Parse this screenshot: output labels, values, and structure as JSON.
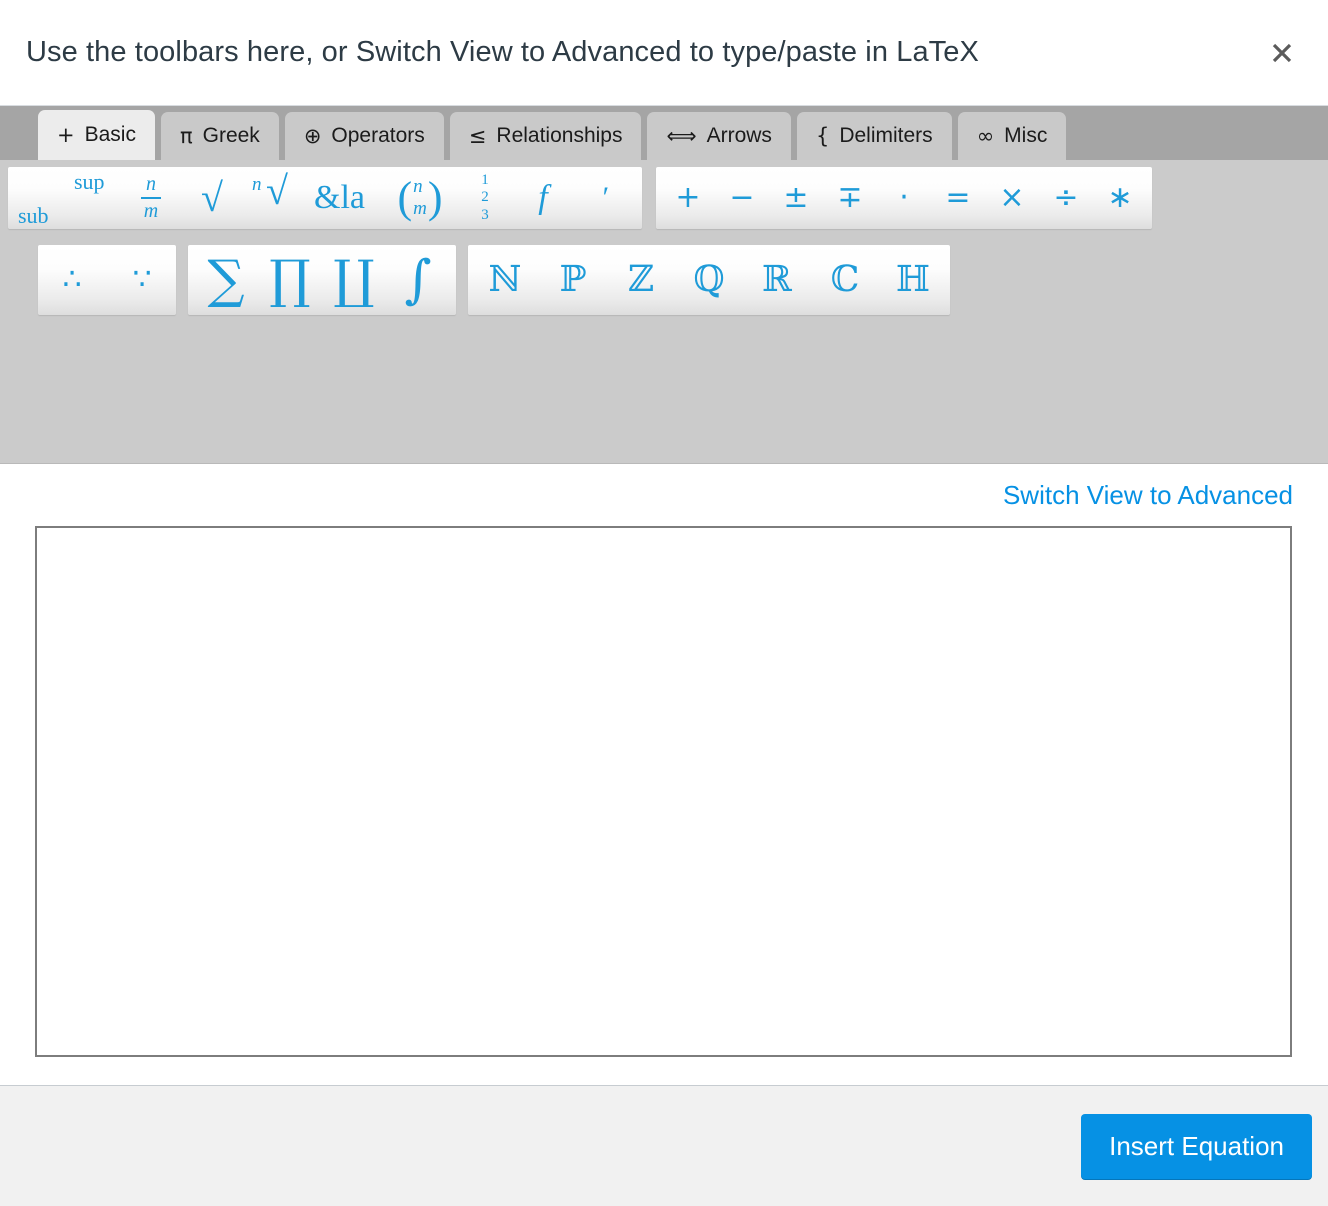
{
  "header": {
    "title": "Use the toolbars here, or Switch View to Advanced to type/paste in LaTeX",
    "close_icon": "close-icon"
  },
  "tabs": [
    {
      "icon": "+",
      "icon_name": "plus-icon",
      "label": "Basic",
      "active": true
    },
    {
      "icon": "π",
      "icon_name": "pi-icon",
      "label": "Greek",
      "active": false
    },
    {
      "icon": "⊕",
      "icon_name": "circled-plus-icon",
      "label": "Operators",
      "active": false
    },
    {
      "icon": "≤",
      "icon_name": "less-equal-icon",
      "label": "Relationships",
      "active": false
    },
    {
      "icon": "⟺",
      "icon_name": "double-arrow-icon",
      "label": "Arrows",
      "active": false
    },
    {
      "icon": "{",
      "icon_name": "brace-icon",
      "label": "Delimiters",
      "active": false
    },
    {
      "icon": "∞",
      "icon_name": "infinity-icon",
      "label": "Misc",
      "active": false
    }
  ],
  "toolbar": {
    "row1": {
      "group1": {
        "supsub": {
          "sup": "sup",
          "sub": "sub"
        },
        "fraction": {
          "numerator": "n",
          "denominator": "m"
        },
        "sqrt": "√",
        "nthroot": {
          "index": "n",
          "radical": "√"
        },
        "amp": "&la",
        "binomial": {
          "open": "(",
          "top": "n",
          "bottom": "m",
          "close": ")"
        },
        "stack123": {
          "l1": "1",
          "l2": "2",
          "l3": "3"
        },
        "func": "f",
        "prime": "′"
      },
      "group2": [
        {
          "glyph": "+",
          "name": "plus-button"
        },
        {
          "glyph": "−",
          "name": "minus-button"
        },
        {
          "glyph": "±",
          "name": "plus-minus-button"
        },
        {
          "glyph": "∓",
          "name": "minus-plus-button"
        },
        {
          "glyph": "·",
          "name": "cdot-button"
        },
        {
          "glyph": "=",
          "name": "equals-button"
        },
        {
          "glyph": "×",
          "name": "times-button"
        },
        {
          "glyph": "÷",
          "name": "divide-button"
        },
        {
          "glyph": "∗",
          "name": "asterisk-button"
        }
      ]
    },
    "row2": {
      "group1": [
        {
          "glyph": "∴",
          "name": "therefore-button"
        },
        {
          "glyph": "∵",
          "name": "because-button"
        }
      ],
      "group2": [
        {
          "glyph": "∑",
          "name": "sum-button"
        },
        {
          "glyph": "∏",
          "name": "product-button"
        },
        {
          "glyph": "∐",
          "name": "coproduct-button"
        },
        {
          "glyph": "∫",
          "name": "integral-button"
        }
      ],
      "group3": [
        {
          "glyph": "ℕ",
          "name": "naturals-button"
        },
        {
          "glyph": "ℙ",
          "name": "primes-button"
        },
        {
          "glyph": "ℤ",
          "name": "integers-button"
        },
        {
          "glyph": "ℚ",
          "name": "rationals-button"
        },
        {
          "glyph": "ℝ",
          "name": "reals-button"
        },
        {
          "glyph": "ℂ",
          "name": "complex-button"
        },
        {
          "glyph": "ℍ",
          "name": "quaternions-button"
        }
      ]
    }
  },
  "switch_view": {
    "label": "Switch View to Advanced"
  },
  "editor": {
    "value": "",
    "placeholder": ""
  },
  "footer": {
    "insert_label": "Insert Equation"
  },
  "colors": {
    "accent": "#0691e4",
    "symbol_blue": "#1f9bd8",
    "title_text": "#2d3b45",
    "toolbar_bg": "#cbcbcb",
    "tabstrip_bg": "#a5a5a5",
    "tab_inactive": "#c9c9c9",
    "tab_active": "#ececec",
    "footer_bg": "#f1f1f1",
    "editor_border": "#7d7d7d"
  }
}
